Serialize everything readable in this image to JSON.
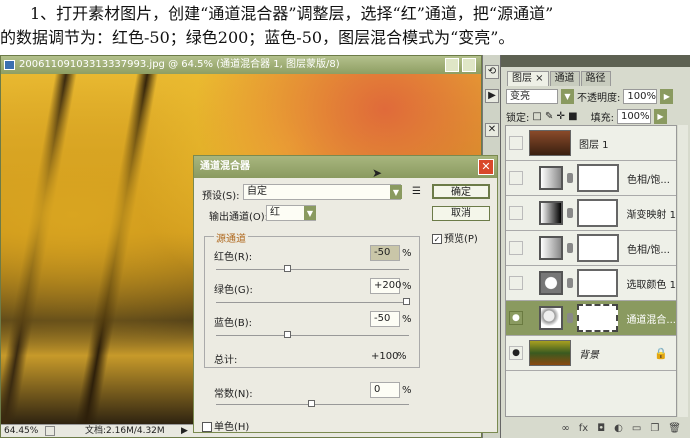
{
  "intro": {
    "line1": "1、打开素材图片，创建“通道混合器”调整层，选择“红”通道，把“源通道”",
    "line2": "的数据调节为：红色-50；绿色200；蓝色-50，图层混合模式为“变亮”。"
  },
  "document": {
    "title": "20061109103313337993.jpg @ 64.5% (通道混合器 1, 图层蒙版/8)",
    "zoom": "64.45%",
    "doc_size": "文档:2.16M/4.32M"
  },
  "layers_panel": {
    "tabs": [
      "图层 ×",
      "通道",
      "路径"
    ],
    "blend_mode": "变亮",
    "opacity_label": "不透明度:",
    "opacity": "100%",
    "lock_label": "锁定:",
    "fill_label": "填充:",
    "fill": "100%",
    "layers": [
      {
        "name": "图层 1",
        "visible": false
      },
      {
        "name": "色相/饱...",
        "visible": false
      },
      {
        "name": "渐变映射 1",
        "visible": false
      },
      {
        "name": "色相/饱...",
        "visible": false
      },
      {
        "name": "选取颜色 1",
        "visible": false
      },
      {
        "name": "通道混合...",
        "visible": true,
        "selected": true
      },
      {
        "name": "背景",
        "visible": true,
        "locked": true
      }
    ]
  },
  "dialog": {
    "title": "通道混合器",
    "preset_label": "预设(S):",
    "preset": "自定",
    "output_label": "输出通道(O):",
    "output": "红",
    "ok": "确定",
    "cancel": "取消",
    "preview": "预览(P)",
    "source_group": "源通道",
    "red_label": "红色(R):",
    "red": "-50",
    "green_label": "绿色(G):",
    "green": "+200",
    "blue_label": "蓝色(B):",
    "blue": "-50",
    "total_label": "总计:",
    "total": "+100",
    "pct": "%",
    "constant_label": "常数(N):",
    "constant": "0",
    "mono": "单色(H)",
    "slider_values": {
      "red": -50,
      "green": 200,
      "blue": -50,
      "constant": 0
    }
  },
  "colors": {
    "accent": "#8a9a60",
    "close": "#d9482b"
  }
}
